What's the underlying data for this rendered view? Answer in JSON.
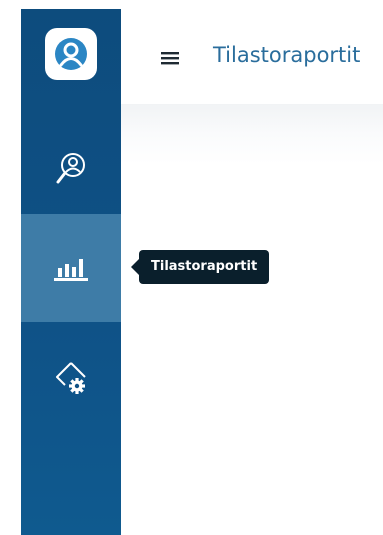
{
  "header": {
    "title": "Tilastoraportit",
    "menu_icon": "hamburger-menu-icon"
  },
  "sidebar": {
    "items": [
      {
        "id": "logo",
        "icon": "user-circle-logo-icon"
      },
      {
        "id": "search",
        "icon": "person-search-icon"
      },
      {
        "id": "reports",
        "icon": "bar-chart-icon",
        "active": true
      },
      {
        "id": "settings",
        "icon": "diamond-gear-icon"
      }
    ]
  },
  "tooltip": {
    "text": "Tilastoraportit"
  },
  "colors": {
    "sidebar": "#0f5186",
    "sidebar_active": "#3e7ca7",
    "title": "#2a6d9c",
    "tooltip_bg": "#0a1f2c"
  }
}
